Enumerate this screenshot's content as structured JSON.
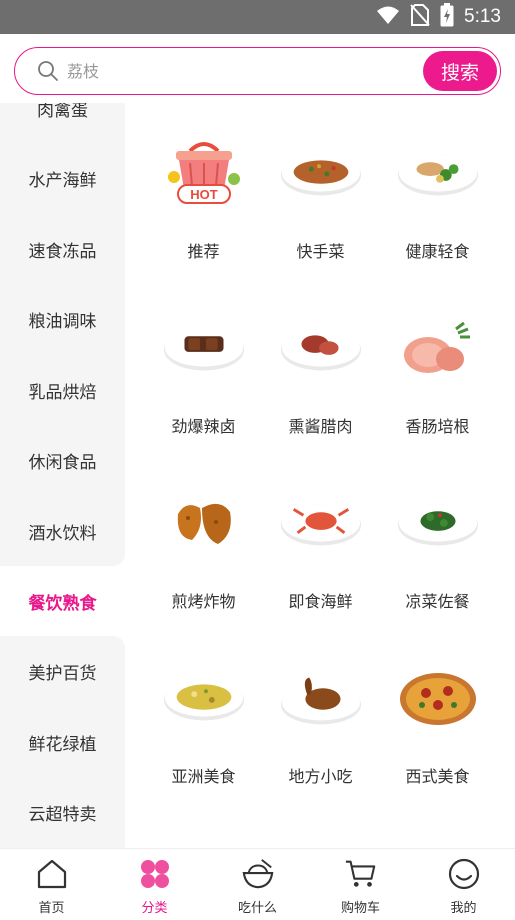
{
  "status": {
    "time": "5:13"
  },
  "search": {
    "placeholder": "荔枝",
    "button": "搜索"
  },
  "sidebar": {
    "items": [
      {
        "label": "肉禽蛋"
      },
      {
        "label": "水产海鲜"
      },
      {
        "label": "速食冻品"
      },
      {
        "label": "粮油调味"
      },
      {
        "label": "乳品烘焙"
      },
      {
        "label": "休闲食品"
      },
      {
        "label": "酒水饮料"
      },
      {
        "label": "餐饮熟食"
      },
      {
        "label": "美护百货"
      },
      {
        "label": "鲜花绿植"
      },
      {
        "label": "云超特卖"
      }
    ],
    "active_index": 7
  },
  "grid": {
    "items": [
      {
        "label": "推荐",
        "icon": "hot-basket-icon",
        "hot_badge": "HOT"
      },
      {
        "label": "快手菜",
        "icon": "fried-rice-plate-icon"
      },
      {
        "label": "健康轻食",
        "icon": "chicken-broccoli-plate-icon"
      },
      {
        "label": "劲爆辣卤",
        "icon": "braised-meat-plate-icon"
      },
      {
        "label": "熏酱腊肉",
        "icon": "smoked-meat-plate-icon"
      },
      {
        "label": "香肠培根",
        "icon": "ham-sausage-icon"
      },
      {
        "label": "煎烤炸物",
        "icon": "fried-chicken-icon"
      },
      {
        "label": "即食海鲜",
        "icon": "crab-plate-icon"
      },
      {
        "label": "凉菜佐餐",
        "icon": "cold-greens-plate-icon"
      },
      {
        "label": "亚洲美食",
        "icon": "curry-plate-icon"
      },
      {
        "label": "地方小吃",
        "icon": "roast-duck-plate-icon"
      },
      {
        "label": "西式美食",
        "icon": "pizza-icon"
      }
    ]
  },
  "tabbar": {
    "items": [
      {
        "label": "首页",
        "icon": "home-icon"
      },
      {
        "label": "分类",
        "icon": "category-icon"
      },
      {
        "label": "吃什么",
        "icon": "bowl-icon"
      },
      {
        "label": "购物车",
        "icon": "cart-icon"
      },
      {
        "label": "我的",
        "icon": "smile-icon"
      }
    ],
    "active_index": 1
  },
  "colors": {
    "accent": "#ec1a8c",
    "statusbar": "#6e6e6e",
    "sidebar_bg": "#f5f5f5"
  }
}
